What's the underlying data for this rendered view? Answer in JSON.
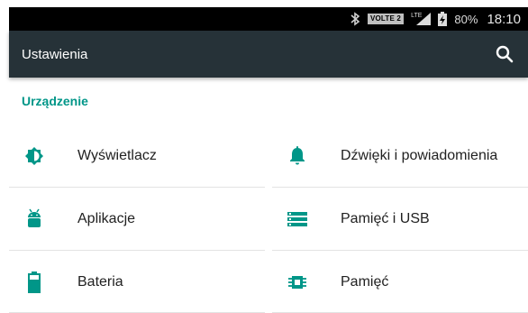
{
  "status_bar": {
    "volte": "VOLTE 2",
    "network": "LTE",
    "battery": "80%",
    "time": "18:10"
  },
  "toolbar": {
    "title": "Ustawienia",
    "search_icon": "search-icon"
  },
  "section": {
    "header": "Urządzenie"
  },
  "items": [
    {
      "label": "Wyświetlacz",
      "icon": "brightness-icon"
    },
    {
      "label": "Dźwięki i powiadomienia",
      "icon": "bell-icon"
    },
    {
      "label": "Aplikacje",
      "icon": "android-icon"
    },
    {
      "label": "Pamięć i USB",
      "icon": "storage-icon"
    },
    {
      "label": "Bateria",
      "icon": "battery-icon"
    },
    {
      "label": "Pamięć",
      "icon": "memory-icon"
    }
  ],
  "colors": {
    "accent": "#009688",
    "toolbar": "#263238",
    "statusbar": "#000000"
  }
}
